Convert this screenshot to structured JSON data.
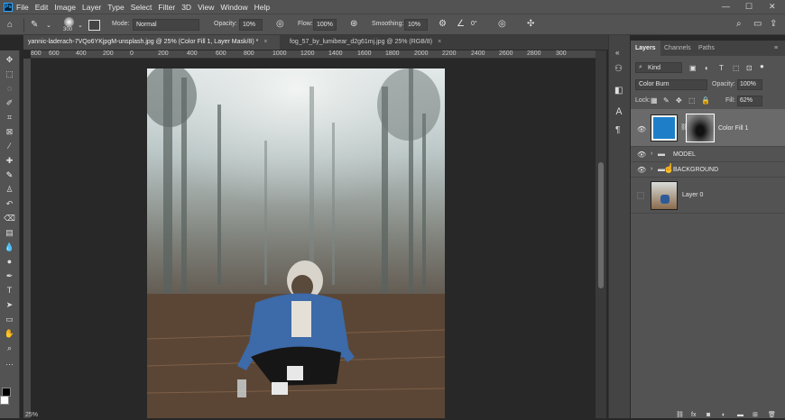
{
  "app": {
    "logo": "Ps"
  },
  "menu": [
    "File",
    "Edit",
    "Image",
    "Layer",
    "Type",
    "Select",
    "Filter",
    "3D",
    "View",
    "Window",
    "Help"
  ],
  "window_controls": [
    "—",
    "☐",
    "✕"
  ],
  "options": {
    "brush_size": "300",
    "mode_label": "Mode:",
    "mode_value": "Normal",
    "opacity_label": "Opacity:",
    "opacity_value": "10%",
    "flow_label": "Flow:",
    "flow_value": "100%",
    "smoothing_label": "Smoothing:",
    "smoothing_value": "10%",
    "angle_value": "0°"
  },
  "tabs": [
    {
      "label": "yannic-laderach-7VQo6YKjpgM-unsplash.jpg @ 25% (Color Fill 1, Layer Mask/8) *",
      "close": "×"
    },
    {
      "label": "fog_57_by_lumibear_d2g61mj.jpg @ 25% (RGB/8)",
      "close": "×"
    }
  ],
  "ruler": [
    "800",
    "600",
    "400",
    "200",
    "0",
    "200",
    "400",
    "600",
    "800",
    "1000",
    "1200",
    "1400",
    "1600",
    "1800",
    "2000",
    "2200",
    "2400",
    "2600",
    "2800",
    "300"
  ],
  "layers_panel": {
    "tabs": [
      "Layers",
      "Channels",
      "Paths"
    ],
    "kind_label": "Kind",
    "blend_mode": "Color Burn",
    "opacity_label": "Opacity:",
    "opacity_value": "100%",
    "lock_label": "Lock:",
    "fill_label": "Fill:",
    "fill_value": "62%",
    "layers": [
      {
        "name": "Color Fill 1"
      },
      {
        "name": "MODEL"
      },
      {
        "name": "BACKGROUND"
      },
      {
        "name": "Layer 0"
      }
    ]
  },
  "status": {
    "zoom": "25%"
  },
  "colors": {
    "fill_swatch": "#1e7fc8",
    "ui_bg": "#535353",
    "canvas_bg": "#282828"
  }
}
